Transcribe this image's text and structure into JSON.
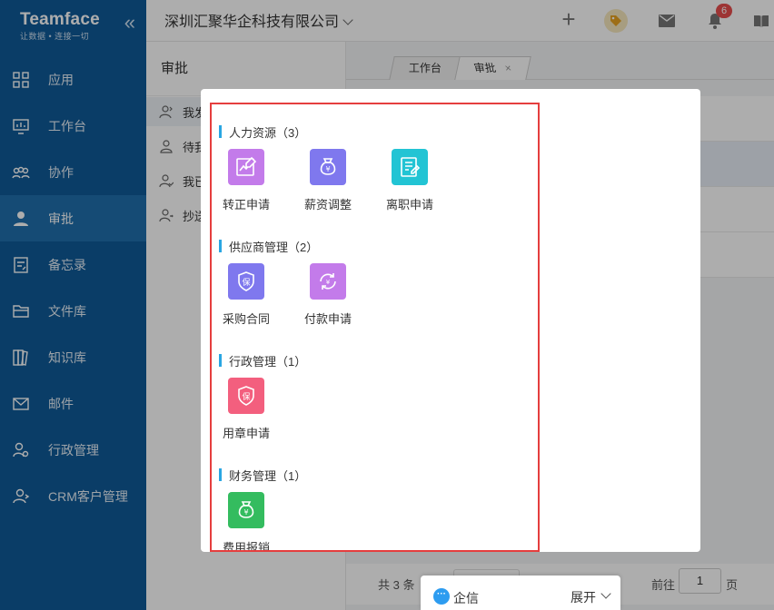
{
  "app": {
    "name": "Teamface",
    "tagline": "让数据 • 连接一切",
    "collapse_glyph": "«"
  },
  "sidebar": {
    "items": [
      {
        "label": "应用",
        "icon": "apps-icon"
      },
      {
        "label": "工作台",
        "icon": "dashboard-icon"
      },
      {
        "label": "协作",
        "icon": "collaboration-icon"
      },
      {
        "label": "审批",
        "icon": "approval-icon",
        "active": true
      },
      {
        "label": "备忘录",
        "icon": "memo-icon"
      },
      {
        "label": "文件库",
        "icon": "folder-icon"
      },
      {
        "label": "知识库",
        "icon": "knowledge-icon"
      },
      {
        "label": "邮件",
        "icon": "mail-icon"
      },
      {
        "label": "行政管理",
        "icon": "admin-icon"
      },
      {
        "label": "CRM客户管理",
        "icon": "crm-icon"
      }
    ]
  },
  "header": {
    "company": "深圳汇聚华企科技有限公司",
    "notification_count": "6"
  },
  "approval": {
    "title": "审批",
    "items": [
      {
        "label": "我发"
      },
      {
        "label": "待我"
      },
      {
        "label": "我已"
      },
      {
        "label": "抄送"
      }
    ]
  },
  "tabs": [
    {
      "label": "工作台"
    },
    {
      "label": "审批",
      "close": "×"
    }
  ],
  "pagination": {
    "total": "共 3 条",
    "goto_label": "前往",
    "page": "1",
    "unit": "页"
  },
  "modal": {
    "groups": [
      {
        "title": "人力资源（3）",
        "apps": [
          {
            "label": "转正申请",
            "color": "#c37bea",
            "icon": "trend-icon"
          },
          {
            "label": "薪资调整",
            "color": "#7f78ee",
            "icon": "money-bag-icon"
          },
          {
            "label": "离职申请",
            "color": "#22c4d4",
            "icon": "document-edit-icon"
          }
        ]
      },
      {
        "title": "供应商管理（2）",
        "apps": [
          {
            "label": "采购合同",
            "color": "#7f78ee",
            "icon": "shield-icon"
          },
          {
            "label": "付款申请",
            "color": "#c37bea",
            "icon": "refresh-yuan-icon"
          }
        ]
      },
      {
        "title": "行政管理（1）",
        "apps": [
          {
            "label": "用章申请",
            "color": "#f35f7e",
            "icon": "shield-icon"
          }
        ]
      },
      {
        "title": "财务管理（1）",
        "apps": [
          {
            "label": "费用报销",
            "color": "#34bc5f",
            "icon": "money-bag-icon"
          }
        ]
      }
    ]
  },
  "qixin": {
    "label": "企信",
    "expand_label": "展开"
  }
}
